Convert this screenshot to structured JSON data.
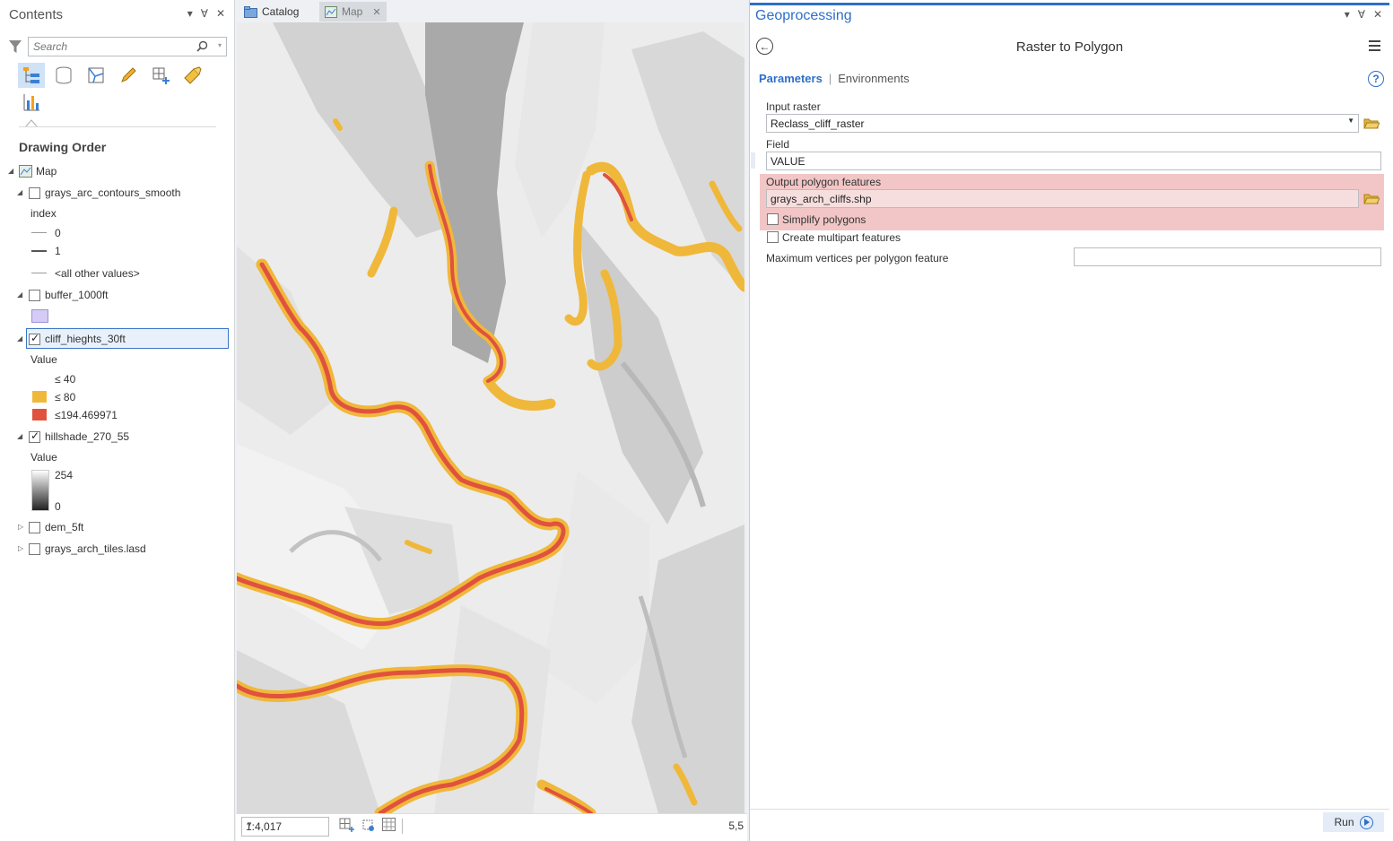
{
  "contents": {
    "title": "Contents",
    "search_placeholder": "Search",
    "drawing_order_label": "Drawing Order",
    "map_label": "Map",
    "layers": [
      {
        "name": "grays_arc_contours_smooth",
        "checked": false,
        "legend_title": "index",
        "legend": [
          "0",
          "1",
          "<all other values>"
        ]
      },
      {
        "name": "buffer_1000ft",
        "checked": false,
        "swatch_color": "#d4ccf4"
      },
      {
        "name": "cliff_hieghts_30ft",
        "checked": true,
        "legend_title": "Value",
        "legend": [
          "≤ 40",
          "≤ 80",
          "≤194.469971"
        ],
        "colors": [
          "#ffffff",
          "#f0b83a",
          "#e0523e"
        ]
      },
      {
        "name": "hillshade_270_55",
        "checked": true,
        "legend_title": "Value",
        "ramp_max": "254",
        "ramp_min": "0"
      },
      {
        "name": "dem_5ft",
        "checked": false
      },
      {
        "name": "grays_arch_tiles.lasd",
        "checked": false
      }
    ]
  },
  "tabs": [
    {
      "label": "Catalog",
      "icon": "catalog-icon"
    },
    {
      "label": "Map",
      "icon": "map-icon"
    }
  ],
  "map": {
    "scale": "1:4,017",
    "coordinate_stub": "5,5",
    "colors": {
      "low": "#f0b83a",
      "high": "#e0523e"
    }
  },
  "geoprocessing": {
    "title": "Geoprocessing",
    "tool_name": "Raster to Polygon",
    "tab_parameters": "Parameters",
    "tab_environments": "Environments",
    "input_raster_label": "Input raster",
    "input_raster_value": "Reclass_cliff_raster",
    "field_label": "Field",
    "field_value": "VALUE",
    "output_label": "Output polygon features",
    "output_value": "grays_arch_cliffs.shp",
    "simplify_label": "Simplify polygons",
    "multipart_label": "Create multipart features",
    "max_vertices_label": "Maximum vertices per polygon feature",
    "max_vertices_value": "",
    "run_label": "Run",
    "accent": "#2d6fca",
    "error_band_color": "#f2c6c6"
  }
}
